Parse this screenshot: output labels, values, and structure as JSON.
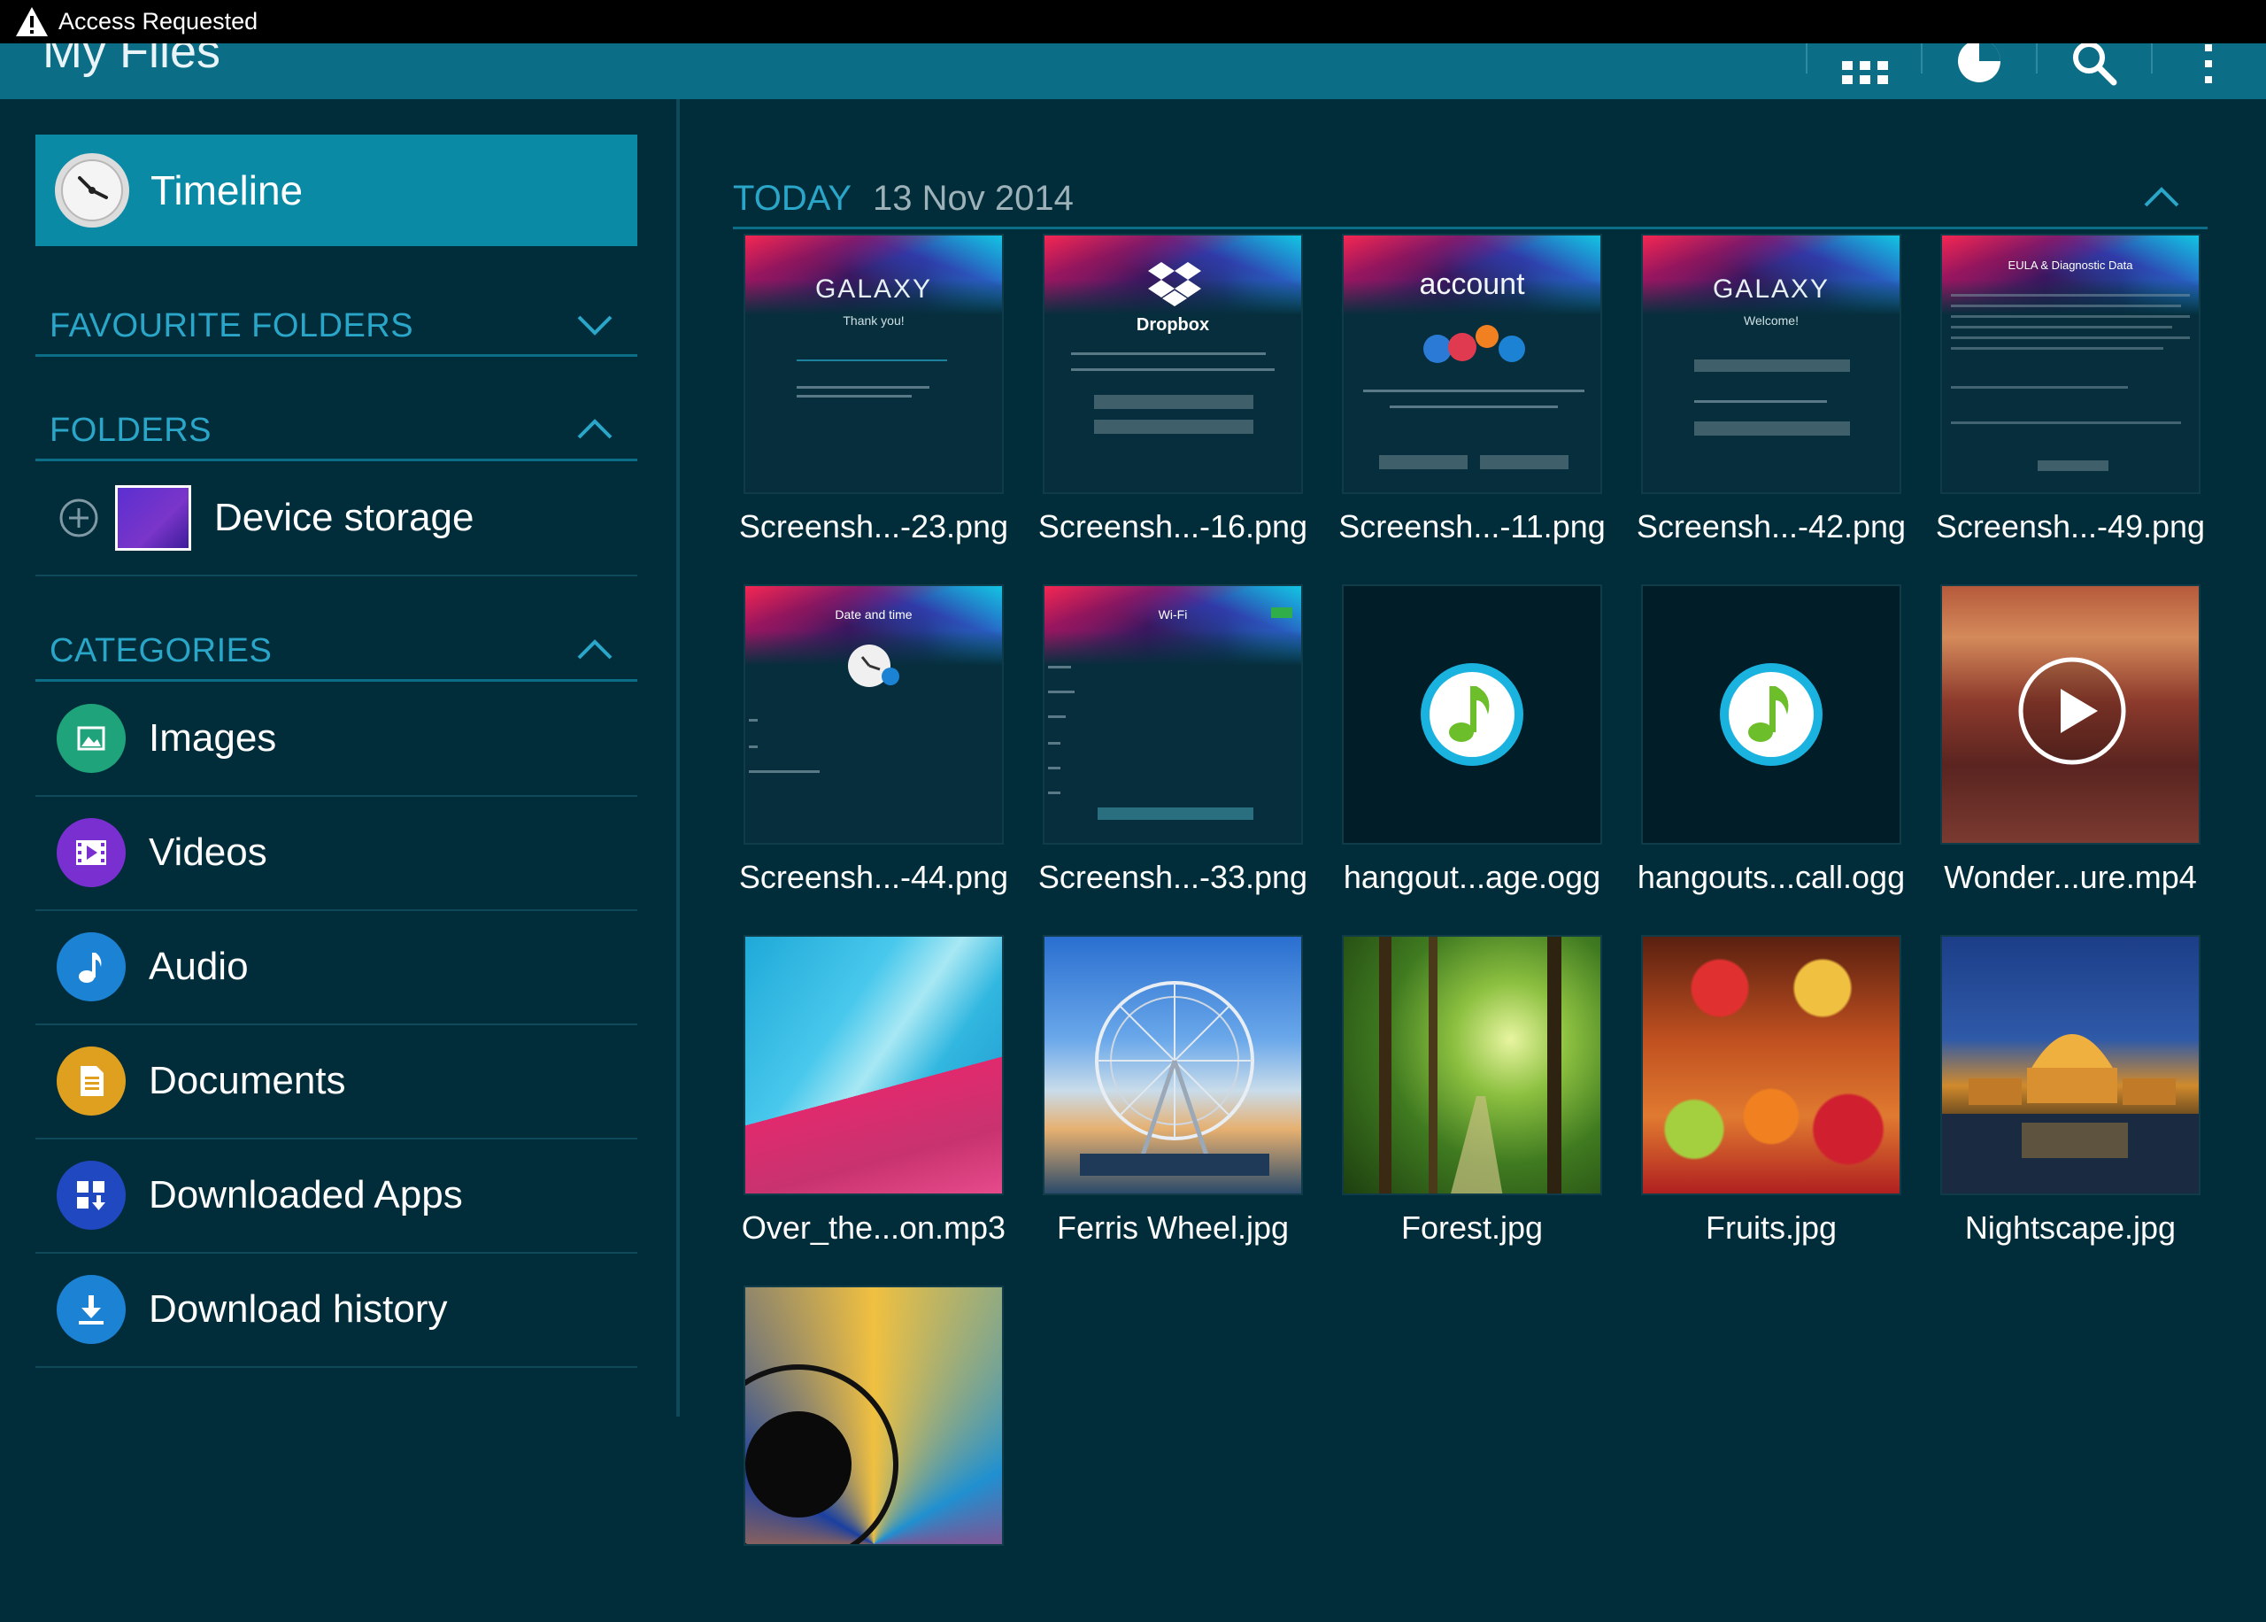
{
  "status_bar": {
    "notification": "Access Requested",
    "icon": "warning-icon"
  },
  "action_bar": {
    "title": "My Files",
    "icons": [
      "grid-view-icon",
      "storage-usage-icon",
      "search-icon",
      "overflow-menu-icon"
    ]
  },
  "sidebar": {
    "timeline_label": "Timeline",
    "favourite_folders": "FAVOURITE FOLDERS",
    "folders": "FOLDERS",
    "device_storage": "Device storage",
    "categories": "CATEGORIES",
    "category_items": [
      {
        "label": "Images",
        "icon": "images-icon",
        "color": "#1fa37a"
      },
      {
        "label": "Videos",
        "icon": "videos-icon",
        "color": "#7a2fd0"
      },
      {
        "label": "Audio",
        "icon": "audio-icon",
        "color": "#1b82d4"
      },
      {
        "label": "Documents",
        "icon": "documents-icon",
        "color": "#dfa020"
      },
      {
        "label": "Downloaded Apps",
        "icon": "downloaded-apps-icon",
        "color": "#2048c0"
      },
      {
        "label": "Download history",
        "icon": "download-history-icon",
        "color": "#1b82d4"
      }
    ]
  },
  "main": {
    "section_label": "TODAY",
    "section_date": "13 Nov 2014",
    "files": [
      {
        "name": "Screensh...-23.png",
        "kind": "screenshot",
        "caption": "GALAXY",
        "subcaption": "Thank you!"
      },
      {
        "name": "Screensh...-16.png",
        "kind": "screenshot",
        "caption": "Dropbox"
      },
      {
        "name": "Screensh...-11.png",
        "kind": "screenshot",
        "caption": "account"
      },
      {
        "name": "Screensh...-42.png",
        "kind": "screenshot",
        "caption": "GALAXY",
        "subcaption": "Welcome!"
      },
      {
        "name": "Screensh...-49.png",
        "kind": "screenshot",
        "caption": "EULA & Diagnostic Data"
      },
      {
        "name": "Screensh...-44.png",
        "kind": "screenshot",
        "caption": "Date and time"
      },
      {
        "name": "Screensh...-33.png",
        "kind": "screenshot",
        "caption": "Wi-Fi"
      },
      {
        "name": "hangout...age.ogg",
        "kind": "audio"
      },
      {
        "name": "hangouts...call.ogg",
        "kind": "audio"
      },
      {
        "name": "Wonder...ure.mp4",
        "kind": "video"
      },
      {
        "name": "Over_the...on.mp3",
        "kind": "audio-art"
      },
      {
        "name": "Ferris Wheel.jpg",
        "kind": "image"
      },
      {
        "name": "Forest.jpg",
        "kind": "image"
      },
      {
        "name": "Fruits.jpg",
        "kind": "image"
      },
      {
        "name": "Nightscape.jpg",
        "kind": "image"
      },
      {
        "name": "",
        "kind": "image"
      }
    ]
  },
  "colors": {
    "accent": "#2aa6c9",
    "action_bar": "#0b6d86",
    "background": "#012c3a",
    "selected": "#0b8aa6"
  }
}
